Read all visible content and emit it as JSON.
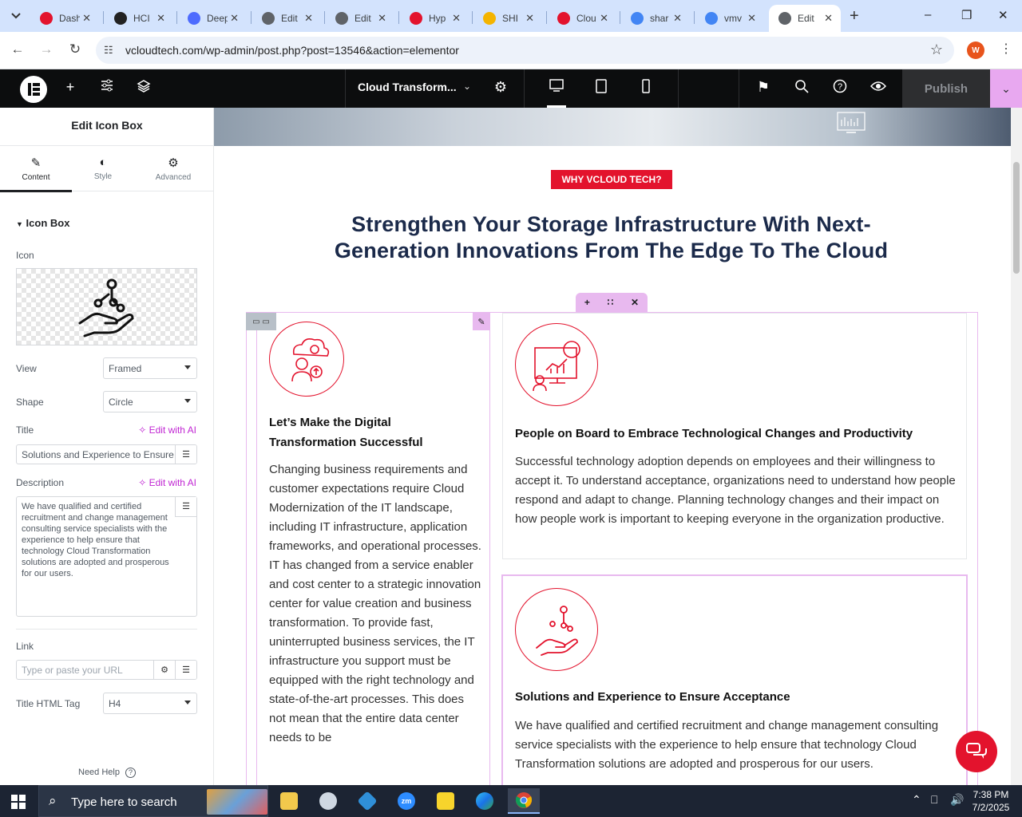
{
  "browser": {
    "tabs": [
      {
        "label": "Dash",
        "color": "#e3132d"
      },
      {
        "label": "HCI",
        "color": "#222222"
      },
      {
        "label": "Deep",
        "color": "#4d6bfe"
      },
      {
        "label": "Edit",
        "color": "#5f6368"
      },
      {
        "label": "Edit",
        "color": "#5f6368"
      },
      {
        "label": "Hyp",
        "color": "#e3132d"
      },
      {
        "label": "SHI",
        "color": "#f4b400"
      },
      {
        "label": "Clou",
        "color": "#e3132d"
      },
      {
        "label": "shar",
        "color": "#4285f4"
      },
      {
        "label": "vmv",
        "color": "#4285f4"
      },
      {
        "label": "Edit",
        "color": "#5f6368"
      }
    ],
    "active_tab_index": 10,
    "url": "vcloudtech.com/wp-admin/post.php?post=13546&action=elementor",
    "profile_initial": "W"
  },
  "editor": {
    "document_name": "Cloud Transform...",
    "publish_label": "Publish"
  },
  "panel": {
    "title": "Edit Icon Box",
    "tabs": [
      {
        "label": "Content",
        "icon": "pencil-icon"
      },
      {
        "label": "Style",
        "icon": "half-circle-icon"
      },
      {
        "label": "Advanced",
        "icon": "gear-icon"
      }
    ],
    "section": "Icon Box",
    "icon_label": "Icon",
    "view_label": "View",
    "view_value": "Framed",
    "shape_label": "Shape",
    "shape_value": "Circle",
    "title_label": "Title",
    "ai_label": "Edit with AI",
    "title_value": "Solutions and Experience to Ensure Acceptance",
    "description_label": "Description",
    "description_value": "We have qualified and certified recruitment and change management consulting service specialists with the experience to help ensure that technology Cloud Transformation solutions are adopted and prosperous for our users.",
    "link_label": "Link",
    "link_placeholder": "Type or paste your URL",
    "html_tag_label": "Title HTML Tag",
    "html_tag_value": "H4",
    "need_help": "Need Help"
  },
  "page": {
    "badge": "WHY VCLOUD TECH?",
    "headline": "Strengthen Your Storage Infrastructure With Next-Generation Innovations From The Edge To The Cloud",
    "cards": [
      {
        "title": "Let’s Make the Digital Transformation Successful",
        "description": "Changing business requirements and customer expectations require Cloud Modernization of the IT landscape, including IT infrastructure, application frameworks, and operational processes. IT has changed from a service enabler and cost center to a strategic innovation center for value creation and business transformation. To provide fast, uninterrupted business services, the IT infrastructure you support must be equipped with the right technology and state-of-the-art processes. This does not mean that the entire data center needs to be"
      },
      {
        "title": "People on Board to Embrace Technological Changes and Productivity",
        "description": "Successful technology adoption depends on employees and their willingness to accept it. To understand acceptance, organizations need to understand how people respond and adapt to change. Planning technology changes and their impact on how people work is important to keeping everyone in the organization productive."
      },
      {
        "title": "Solutions and Experience to Ensure Acceptance",
        "description": "We have qualified and certified recruitment and change management consulting service specialists with the experience to help ensure that technology Cloud Transformation solutions are adopted and prosperous for our users."
      }
    ]
  },
  "taskbar": {
    "search_placeholder": "Type here to search",
    "time": "7:38 PM",
    "date": "7/2/2025"
  }
}
